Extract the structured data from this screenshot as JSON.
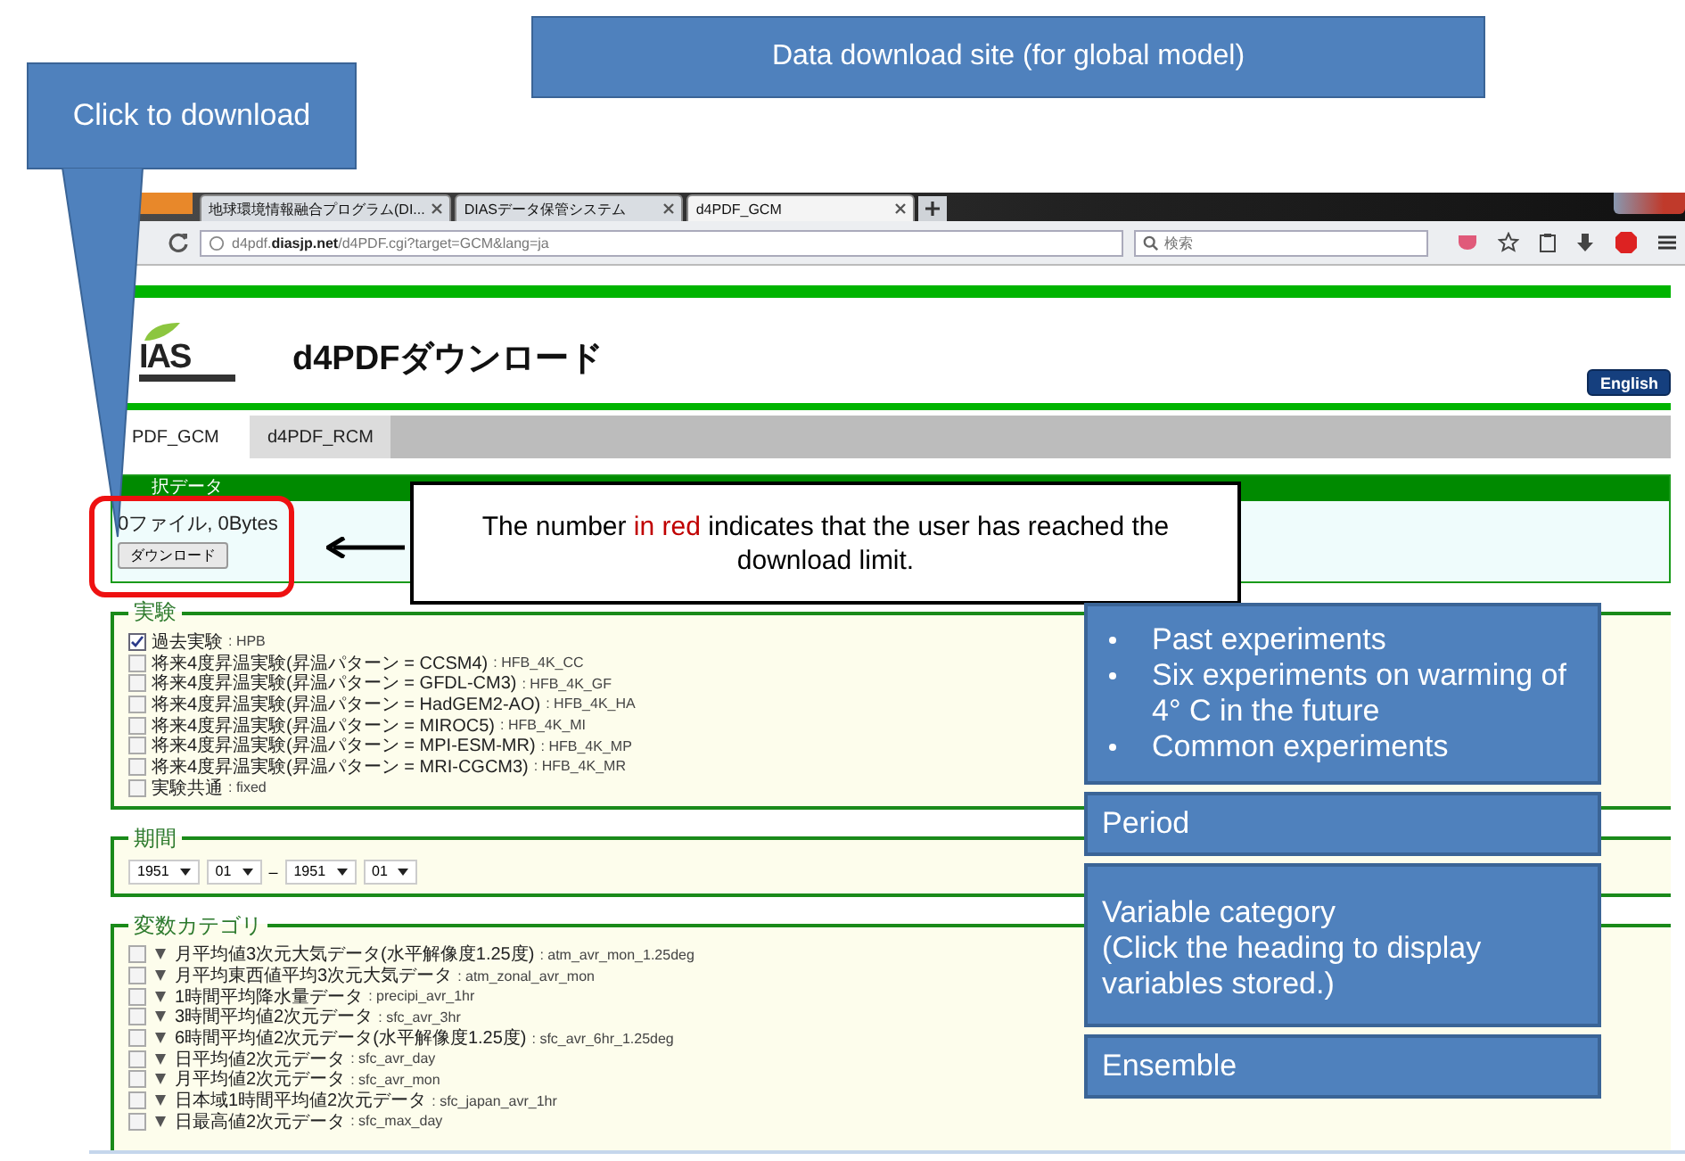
{
  "slide_title": "Data download site (for global model)",
  "download_callout": "Click to download",
  "browser": {
    "tabs": [
      {
        "label": "地球環境情報融合プログラム(DI...",
        "selected": false
      },
      {
        "label": "DIASデータ保管システム",
        "selected": false
      },
      {
        "label": "d4PDF_GCM",
        "selected": true
      }
    ],
    "url": {
      "host_prefix": "d4pdf.",
      "host": "diasjp.net",
      "path": "/d4PDF.cgi?target=GCM&lang=ja"
    },
    "search_placeholder": "検索"
  },
  "page": {
    "logo": "IAS",
    "title": "d4PDFダウンロード",
    "language_button": "English",
    "tabs": [
      {
        "label": "PDF_GCM",
        "selected": true
      },
      {
        "label": "d4PDF_RCM",
        "selected": false
      }
    ],
    "selection": {
      "heading": "択データ",
      "summary": "0ファイル, 0Bytes",
      "button": "ダウンロード"
    },
    "experiments": {
      "legend": "実験",
      "items": [
        {
          "label": "過去実験",
          "code": ": HPB",
          "checked": true
        },
        {
          "label": "将来4度昇温実験(昇温パターン = CCSM4)",
          "code": ": HFB_4K_CC",
          "checked": false
        },
        {
          "label": "将来4度昇温実験(昇温パターン = GFDL-CM3)",
          "code": ": HFB_4K_GF",
          "checked": false
        },
        {
          "label": "将来4度昇温実験(昇温パターン = HadGEM2-AO)",
          "code": ": HFB_4K_HA",
          "checked": false
        },
        {
          "label": "将来4度昇温実験(昇温パターン = MIROC5)",
          "code": ": HFB_4K_MI",
          "checked": false
        },
        {
          "label": "将来4度昇温実験(昇温パターン = MPI-ESM-MR)",
          "code": ": HFB_4K_MP",
          "checked": false
        },
        {
          "label": "将来4度昇温実験(昇温パターン = MRI-CGCM3)",
          "code": ": HFB_4K_MR",
          "checked": false
        },
        {
          "label": "実験共通",
          "code": ": fixed",
          "checked": false
        }
      ]
    },
    "period": {
      "legend": "期間",
      "from_year": "1951",
      "from_month": "01",
      "separator": "–",
      "to_year": "1951",
      "to_month": "01"
    },
    "variables": {
      "legend": "変数カテゴリ",
      "items": [
        {
          "label": "月平均値3次元大気データ(水平解像度1.25度)",
          "code": ": atm_avr_mon_1.25deg",
          "checked": false
        },
        {
          "label": "月平均東西値平均3次元大気データ",
          "code": ": atm_zonal_avr_mon",
          "checked": false
        },
        {
          "label": "1時間平均降水量データ",
          "code": ": precipi_avr_1hr",
          "checked": false
        },
        {
          "label": "3時間平均値2次元データ",
          "code": ": sfc_avr_3hr",
          "checked": false
        },
        {
          "label": "6時間平均値2次元データ(水平解像度1.25度)",
          "code": ": sfc_avr_6hr_1.25deg",
          "checked": false
        },
        {
          "label": "日平均値2次元データ",
          "code": ": sfc_avr_day",
          "checked": false
        },
        {
          "label": "月平均値2次元データ",
          "code": ": sfc_avr_mon",
          "checked": false
        },
        {
          "label": "日本域1時間平均値2次元データ",
          "code": ": sfc_japan_avr_1hr",
          "checked": false
        },
        {
          "label": "日最高値2次元データ",
          "code": ": sfc_max_day",
          "checked": false
        }
      ]
    }
  },
  "limit_note": {
    "before": "The number ",
    "highlight": "in red",
    "after": " indicates that the user has reached the download limit."
  },
  "annotations": [
    {
      "kind": "bullets",
      "items": [
        "Past experiments",
        "Six experiments on warming of 4°  C in the future",
        "Common experiments"
      ]
    },
    {
      "kind": "text",
      "text": "Period"
    },
    {
      "kind": "text",
      "text": "Variable category\n(Click the heading to display variables stored.)"
    },
    {
      "kind": "text",
      "text": "Ensemble"
    }
  ]
}
